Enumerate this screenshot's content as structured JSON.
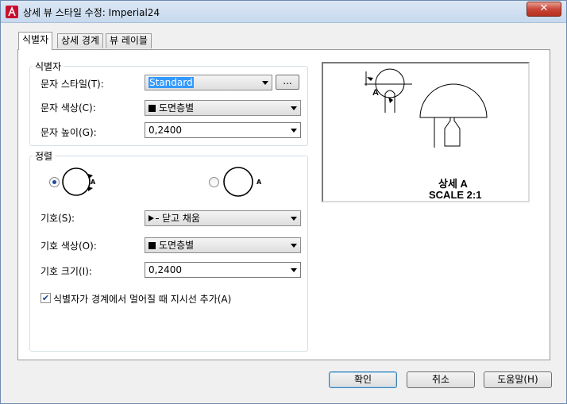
{
  "window": {
    "title": "상세 뷰 스타일 수정: Imperial24",
    "close_label": "✕"
  },
  "tabs": [
    {
      "label": "식별자",
      "active": true
    },
    {
      "label": "상세 경계",
      "active": false
    },
    {
      "label": "뷰 레이블",
      "active": false
    }
  ],
  "identifier_group": {
    "label": "식별자",
    "text_style": {
      "label": "문자 스타일(T):",
      "value": "Standard",
      "browse_label": "..."
    },
    "text_color": {
      "label": "문자 색상(C):",
      "value": "도면층별"
    },
    "text_height": {
      "label": "문자 높이(G):",
      "value": "0,2400"
    }
  },
  "arrangement_group": {
    "label": "정렬",
    "symbol": {
      "label": "기호(S):",
      "value": "닫고 채움"
    },
    "symbol_color": {
      "label": "기호 색상(O):",
      "value": "도면층별"
    },
    "symbol_size": {
      "label": "기호 크기(I):",
      "value": "0,2400"
    },
    "option_a_letter": "A",
    "option_b_letter": "A",
    "leader_checkbox": {
      "label": "식별자가 경계에서 멀어질 때 지시선 추가(A)",
      "checked": true
    }
  },
  "preview": {
    "letter": "A",
    "caption_line1": "상세 A",
    "caption_line2": "SCALE 2:1"
  },
  "buttons": {
    "ok": "확인",
    "cancel": "취소",
    "help": "도움말(H)"
  },
  "colors": {
    "accent": "#3399ff",
    "close": "#c9463a"
  }
}
